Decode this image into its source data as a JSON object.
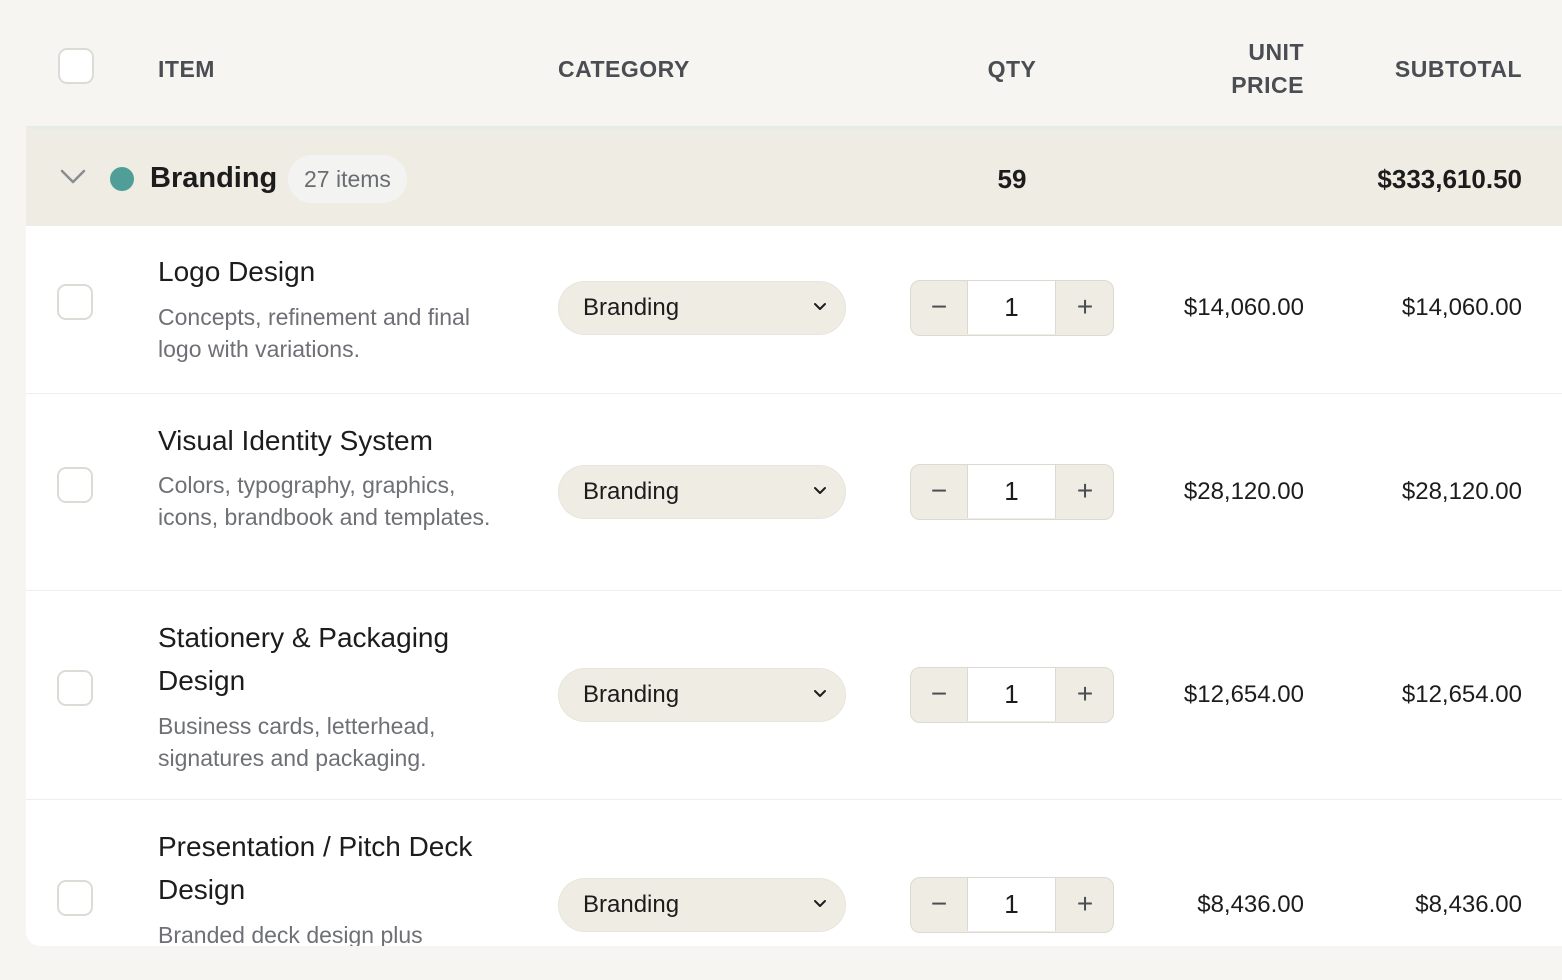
{
  "header": {
    "item": "ITEM",
    "category": "CATEGORY",
    "qty": "QTY",
    "unit_price_line1": "UNIT",
    "unit_price_line2": "PRICE",
    "subtotal": "SUBTOTAL"
  },
  "group": {
    "name": "Branding",
    "badge": "27 items",
    "qty": "59",
    "total": "$333,610.50",
    "dot_color": "#4f9e98"
  },
  "stepper": {
    "minus": "−",
    "plus": "+"
  },
  "rows": [
    {
      "title": "Logo Design",
      "desc": "Concepts, refinement and final logo with variations.",
      "category": "Branding",
      "qty": "1",
      "unit_price": "$14,060.00",
      "subtotal": "$14,060.00"
    },
    {
      "title": "Visual Identity System",
      "desc": "Colors, typography, graphics, icons, brandbook and templates.",
      "category": "Branding",
      "qty": "1",
      "unit_price": "$28,120.00",
      "subtotal": "$28,120.00"
    },
    {
      "title": "Stationery & Packaging Design",
      "desc": "Business cards, letterhead, signatures and packaging.",
      "category": "Branding",
      "qty": "1",
      "unit_price": "$12,654.00",
      "subtotal": "$12,654.00"
    },
    {
      "title": "Presentation / Pitch Deck Design",
      "desc": "Branded deck design plus",
      "category": "Branding",
      "qty": "1",
      "unit_price": "$8,436.00",
      "subtotal": "$8,436.00"
    }
  ]
}
